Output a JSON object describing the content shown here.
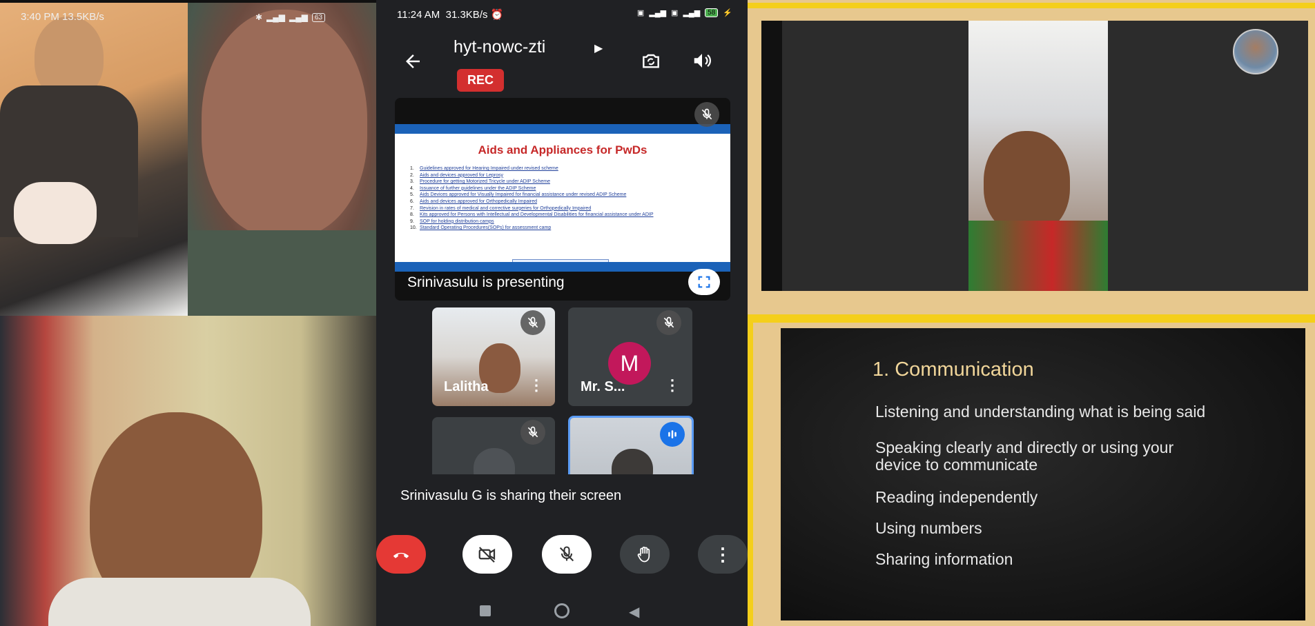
{
  "left_status": {
    "time": "3:40 PM",
    "speed": "13.5KB/s",
    "battery": "63"
  },
  "phone": {
    "status": {
      "time": "11:24 AM",
      "speed": "31.3KB/s",
      "battery": "58"
    },
    "meeting_code": "hyt-nowc-zti",
    "rec_label": "REC",
    "shared_slide": {
      "title": "Aids and Appliances for PwDs",
      "items": [
        {
          "n": "1.",
          "t": "Guidelines approved for Hearing Impaired under revised scheme"
        },
        {
          "n": "2.",
          "t": "Aids and devices approved for Leprosy"
        },
        {
          "n": "3.",
          "t": "Procedure for getting Motorized Tricycle under ADIP Scheme"
        },
        {
          "n": "4.",
          "t": "Issuance of further guidelines under the ADIP Scheme"
        },
        {
          "n": "5.",
          "t": "Aids Devices approved for Visually Impaired for financial assistance under revised ADIP Scheme"
        },
        {
          "n": "6.",
          "t": "Aids and devices approved for Orthopedically Impaired"
        },
        {
          "n": "7.",
          "t": "Revision in rates of medical and corrective surgeries for Orthopedically Impaired"
        },
        {
          "n": "8.",
          "t": "Kits approved for Persons with Intellectual and Developmental Disabilities for financial assistance under ADIP"
        },
        {
          "n": "9.",
          "t": "SOP for holding distribution camps"
        },
        {
          "n": "10.",
          "t": "Standard Operating Procedures(SOPs) for assessment camp"
        }
      ]
    },
    "presenting_text": "Srinivasulu is presenting",
    "participants": [
      {
        "name": "Lalitha"
      },
      {
        "name": "Mr. S...",
        "initial": "M"
      }
    ],
    "caption": "Srinivasulu G is sharing their screen"
  },
  "right_slide": {
    "title": "1. Communication",
    "items": [
      "Listening and understanding what is being said",
      "Speaking clearly and directly or using your",
      "device to communicate",
      "Reading independently",
      "Using numbers",
      "Sharing information"
    ]
  },
  "colors": {
    "end_call": "#e53935",
    "rec": "#d32f2f",
    "accent_blue": "#1a73e8",
    "avatar_m": "#c2185b",
    "frame_yellow": "#f4cf1b"
  }
}
